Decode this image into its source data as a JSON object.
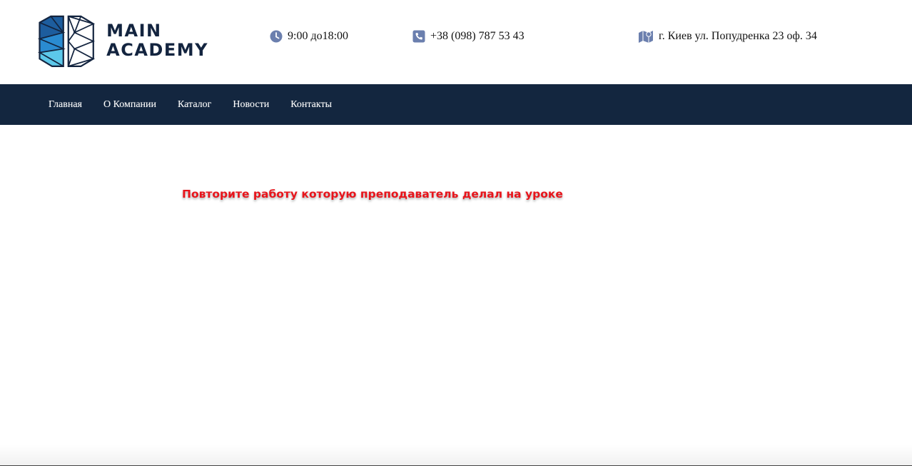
{
  "brand": {
    "line1": "MAIN",
    "line2": "ACADEMY"
  },
  "contacts": {
    "hours": "9:00 до18:00",
    "phone": "+38 (098) 787 53 43",
    "address": "г. Киев ул. Попудренка 23 оф. 34",
    "icons": [
      "clock-icon",
      "phone-icon",
      "map-icon"
    ],
    "icon_color": "#6b7fae"
  },
  "nav": {
    "items": [
      "Главная",
      "О Компании",
      "Каталог",
      "Новости",
      "Контакты"
    ],
    "background": "#13263f"
  },
  "main": {
    "notice": "Повторите работу которую преподаватель делал на уроке",
    "notice_color": "#e8141b"
  }
}
